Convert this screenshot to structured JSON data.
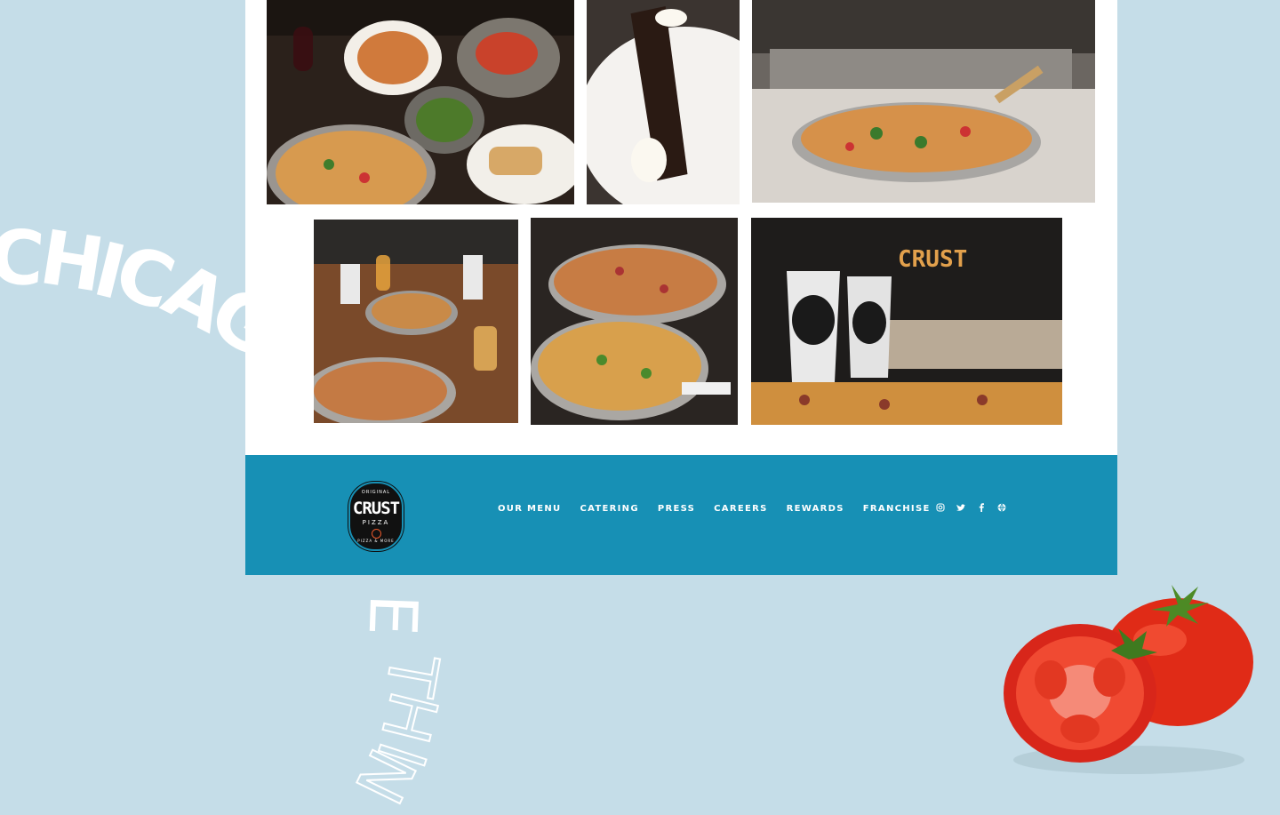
{
  "background": {
    "curved_word_1": [
      "C",
      "H",
      "I",
      "C",
      "A",
      "G"
    ],
    "curved_word_2": [
      "E",
      "T",
      "H",
      "I",
      "N"
    ]
  },
  "gallery": {
    "photos": [
      {
        "name": "table-spread-photo",
        "alt": "Pizza, pasta, salad and sandwiches on a dark table"
      },
      {
        "name": "cannoli-photo",
        "alt": "Chocolate cannoli on a white plate"
      },
      {
        "name": "pizza-counter-photo",
        "alt": "Vegetable pizza on a tray on a marble counter"
      },
      {
        "name": "diners-photo",
        "alt": "Diners sharing pizza and beer"
      },
      {
        "name": "two-pizzas-photo",
        "alt": "Two pizzas on stands"
      },
      {
        "name": "crust-cups-photo",
        "alt": "Crust Pizza branded cups in front of a pizza"
      }
    ]
  },
  "footer": {
    "logo": {
      "arc_top": "ORIGINAL",
      "brand": "CRUST",
      "sub": "PIZZA",
      "arc_bottom": "PIZZA & MORE"
    },
    "nav": [
      {
        "label": "OUR MENU",
        "name": "nav-our-menu"
      },
      {
        "label": "CATERING",
        "name": "nav-catering"
      },
      {
        "label": "PRESS",
        "name": "nav-press"
      },
      {
        "label": "CAREERS",
        "name": "nav-careers"
      },
      {
        "label": "REWARDS",
        "name": "nav-rewards"
      },
      {
        "label": "FRANCHISE",
        "name": "nav-franchise"
      }
    ],
    "social_icons": [
      "instagram-icon",
      "twitter-icon",
      "facebook-icon",
      "globe-icon"
    ]
  },
  "colors": {
    "page_bg": "#c5dde8",
    "footer_bg": "#1790b5",
    "card_bg": "#ffffff"
  }
}
